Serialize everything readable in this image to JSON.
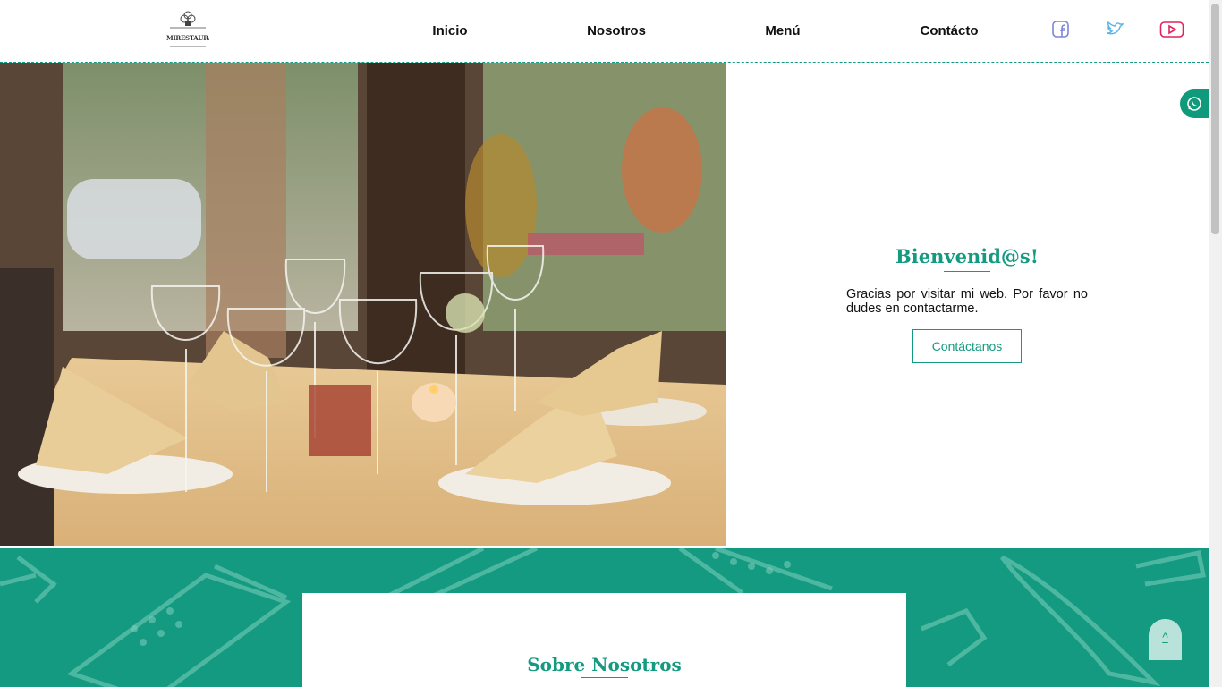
{
  "header": {
    "logo_text": "MIRESTAURANTE",
    "nav": [
      {
        "label": "Inicio"
      },
      {
        "label": "Nosotros"
      },
      {
        "label": "Menú"
      },
      {
        "label": "Contácto"
      }
    ],
    "social": [
      {
        "icon": "facebook-icon",
        "color": "#7b86d3"
      },
      {
        "icon": "twitter-icon",
        "color": "#5ab4e8"
      },
      {
        "icon": "youtube-icon",
        "color": "#e0245e"
      }
    ]
  },
  "hero": {
    "title": "Bienvenid@s!",
    "text": "Gracias por visitar mi web. Por favor no dudes en contactarme.",
    "button": "Contáctanos"
  },
  "about": {
    "title": "Sobre Nosotros"
  },
  "floating": {
    "whatsapp_icon": "whatsapp-icon",
    "top_button": "^"
  },
  "colors": {
    "accent": "#139a80",
    "background": "#ffffff"
  }
}
